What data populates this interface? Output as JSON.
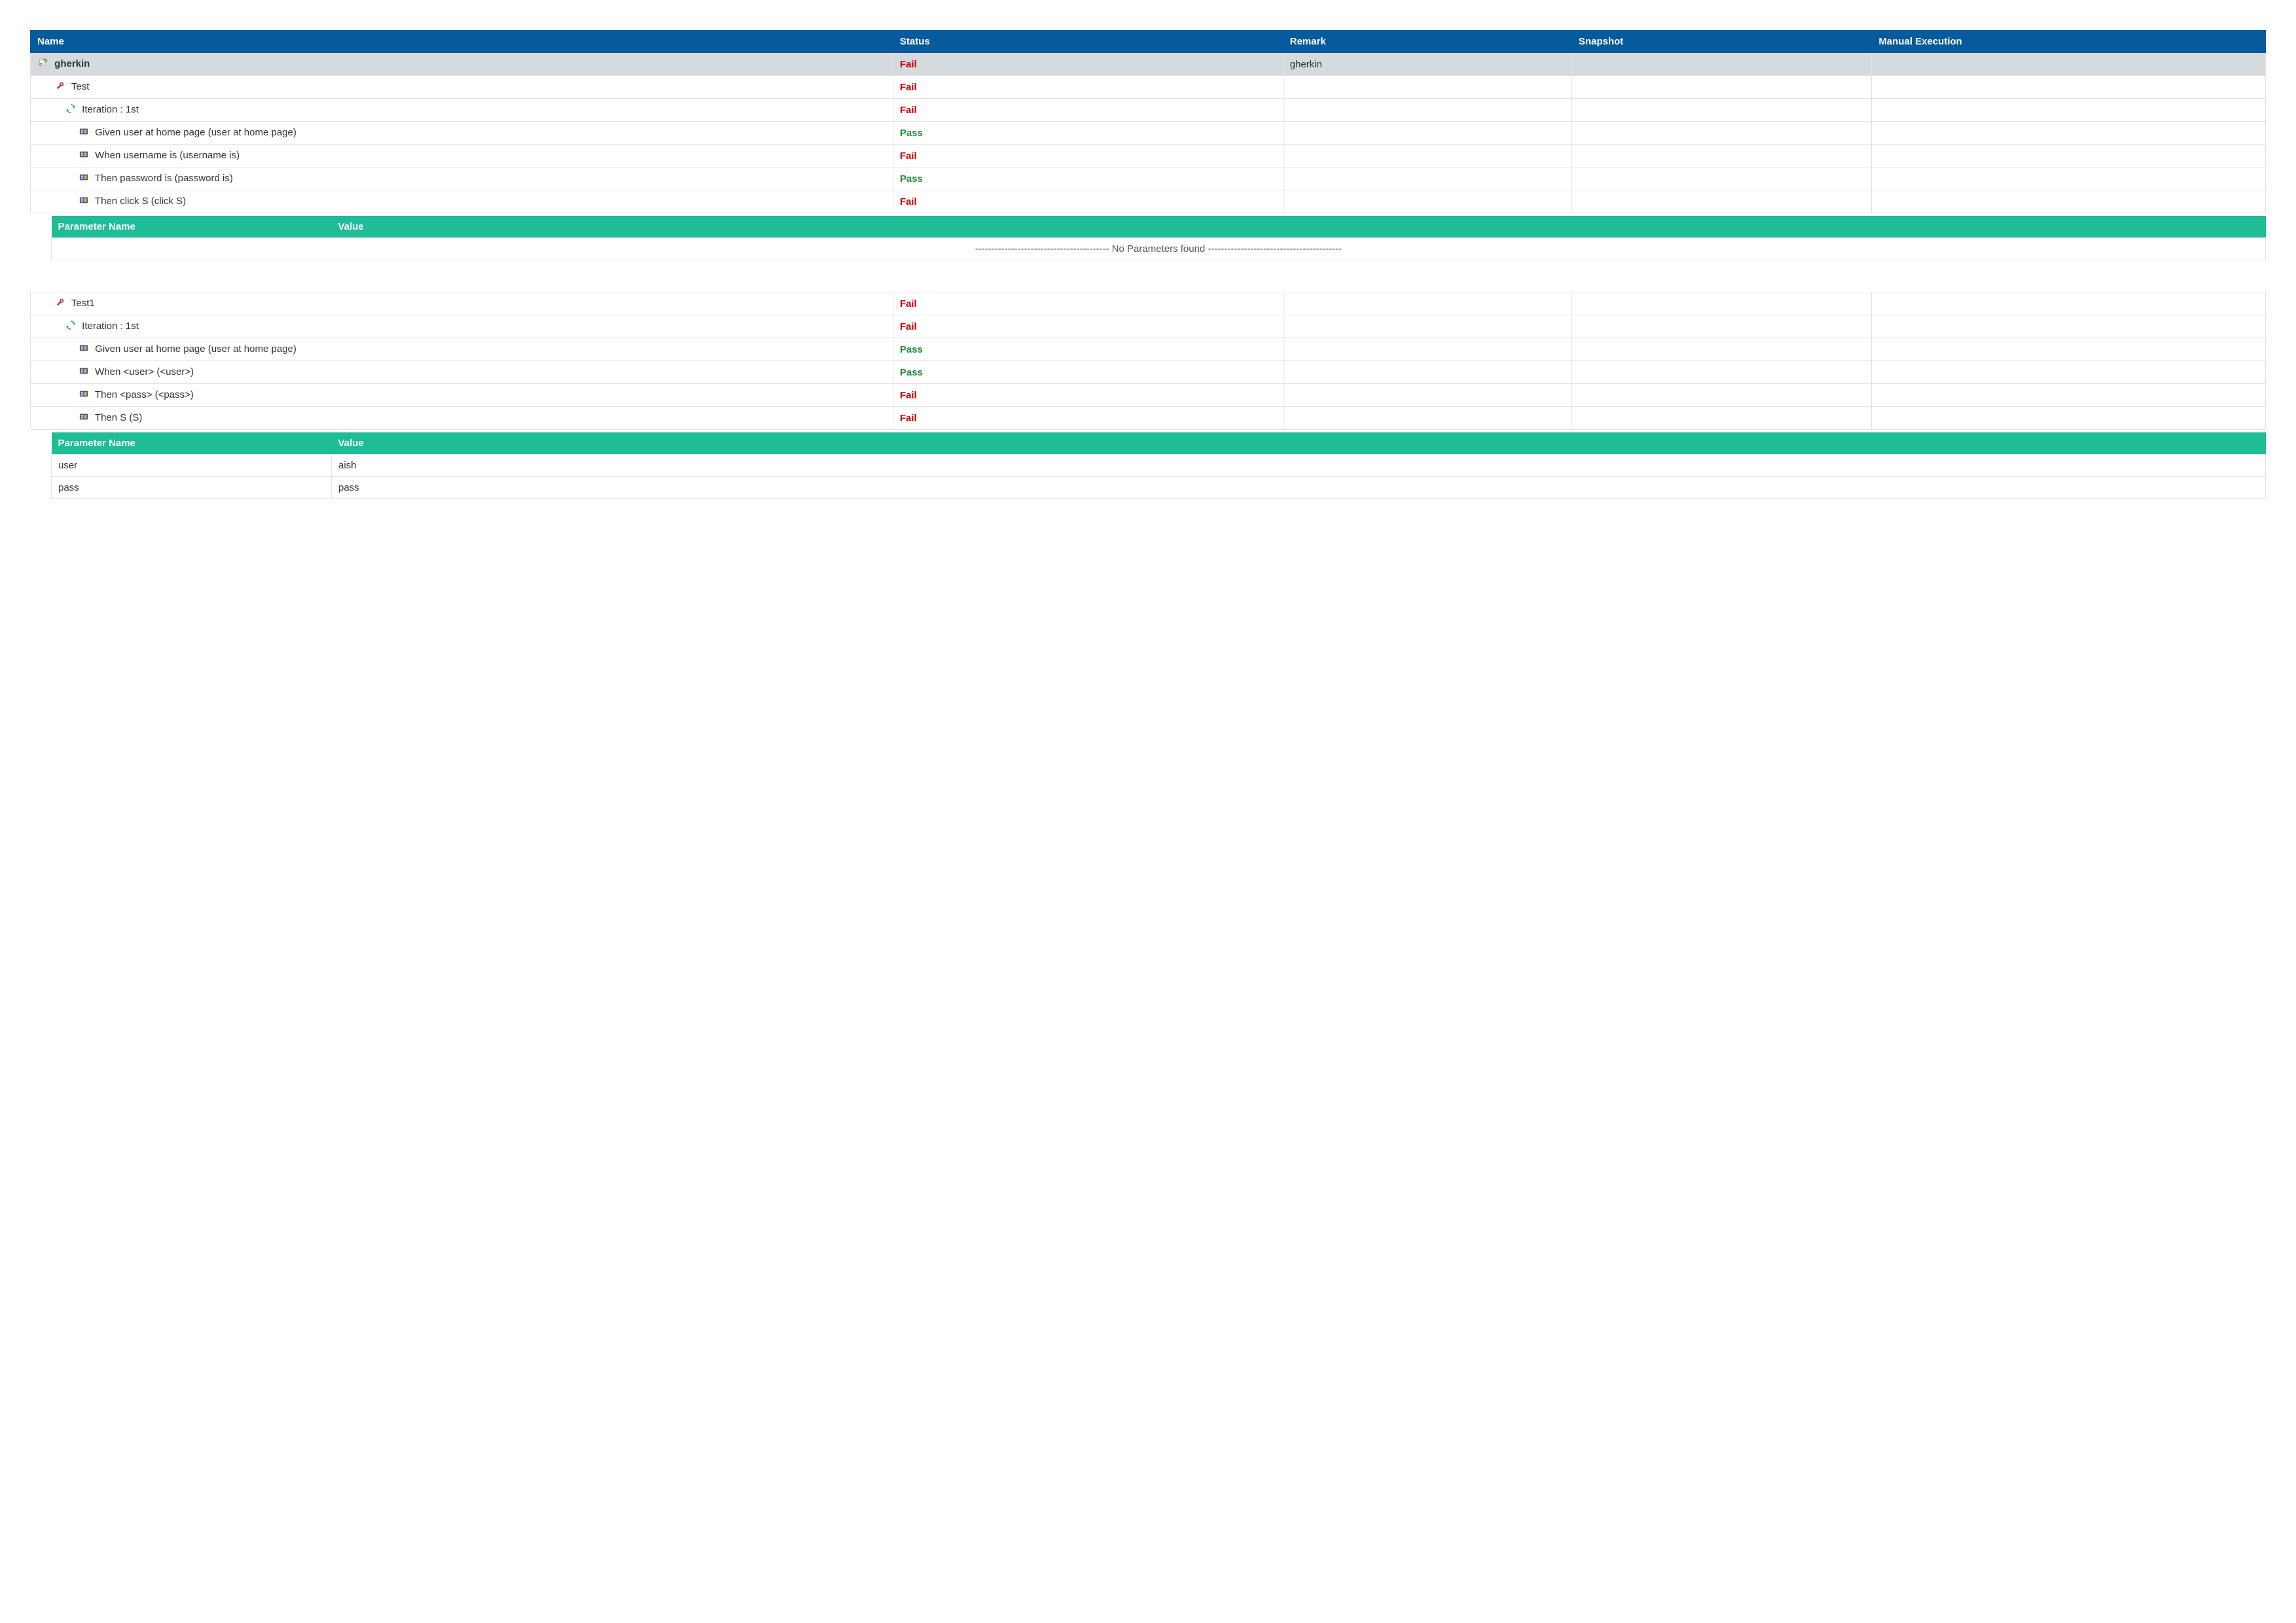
{
  "columns": {
    "name": "Name",
    "status": "Status",
    "remark": "Remark",
    "snapshot": "Snapshot",
    "manual": "Manual Execution"
  },
  "param_columns": {
    "name": "Parameter Name",
    "value": "Value"
  },
  "no_params_msg": "----------------------------------------- No Parameters found -----------------------------------------",
  "feature": {
    "name": "gherkin",
    "status": "Fail",
    "remark": "gherkin"
  },
  "tests": [
    {
      "name": "Test",
      "status": "Fail",
      "iteration": {
        "label": "Iteration : 1st",
        "status": "Fail"
      },
      "steps": [
        {
          "name": "Given user at home page (user at home page)",
          "status": "Pass"
        },
        {
          "name": "When username is (username is)",
          "status": "Fail"
        },
        {
          "name": "Then password is (password is)",
          "status": "Pass"
        },
        {
          "name": "Then click S (click S)",
          "status": "Fail"
        }
      ],
      "params": []
    },
    {
      "name": "Test1",
      "status": "Fail",
      "iteration": {
        "label": "Iteration : 1st",
        "status": "Fail"
      },
      "steps": [
        {
          "name": "Given user at home page (user at home page)",
          "status": "Pass"
        },
        {
          "name": "When <user> (<user>)",
          "status": "Pass"
        },
        {
          "name": "Then <pass> (<pass>)",
          "status": "Fail"
        },
        {
          "name": "Then S (S)",
          "status": "Fail"
        }
      ],
      "params": [
        {
          "name": "user",
          "value": "aish"
        },
        {
          "name": "pass",
          "value": "pass"
        }
      ]
    }
  ]
}
